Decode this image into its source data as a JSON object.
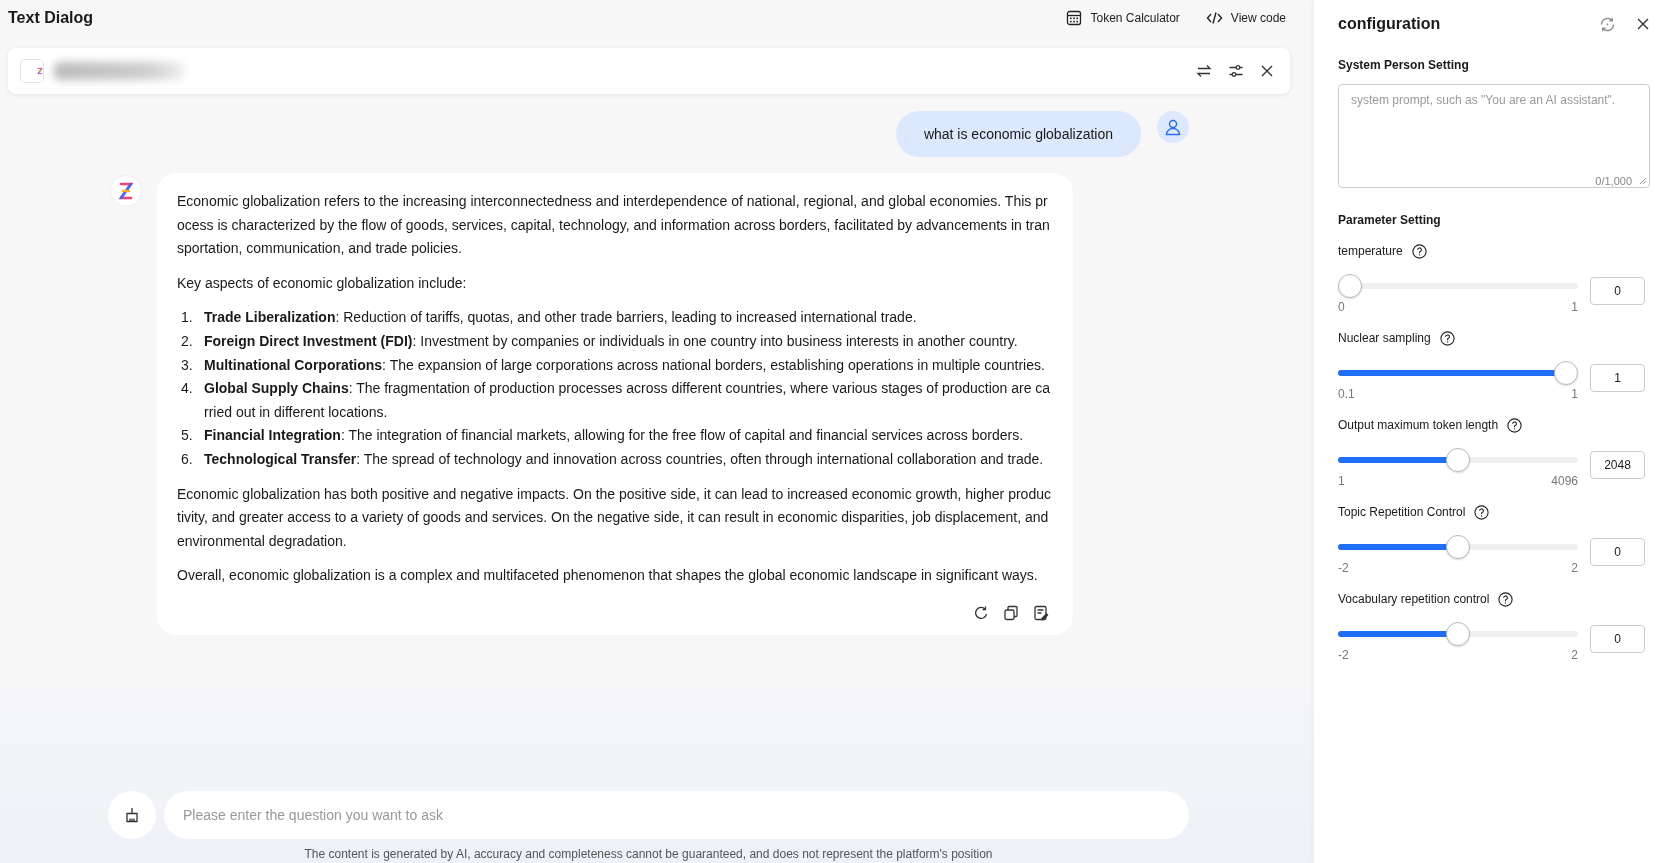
{
  "header": {
    "title": "Text Dialog",
    "actions": [
      {
        "kind": "calculator",
        "label": "Token Calculator"
      },
      {
        "kind": "code",
        "label": "View code"
      }
    ]
  },
  "chat": {
    "user_message": "what is economic globalization",
    "assistant_message": [
      {
        "kind": "paragraph",
        "text": "Economic globalization refers to the increasing interconnectedness and interdependence of national, regional, and global economies. This process is characterized by the flow of goods, services, capital, technology, and information across borders, facilitated by advancements in transportation, communication, and trade policies."
      },
      {
        "kind": "paragraph",
        "text": "Key aspects of economic globalization include:"
      },
      {
        "kind": "list",
        "items": [
          {
            "number": "1.",
            "text": "**Trade Liberalization**: Reduction of tariffs, quotas, and other trade barriers, leading to increased international trade."
          },
          {
            "number": "2.",
            "text": "**Foreign Direct Investment (FDI)**: Investment by companies or individuals in one country into business interests in another country."
          },
          {
            "number": "3.",
            "text": "**Multinational Corporations**: The expansion of large corporations across national borders, establishing operations in multiple countries."
          },
          {
            "number": "4.",
            "text": "**Global Supply Chains**: The fragmentation of production processes across different countries, where various stages of production are carried out in different locations."
          },
          {
            "number": "5.",
            "text": "**Financial Integration**: The integration of financial markets, allowing for the free flow of capital and financial services across borders."
          },
          {
            "number": "6.",
            "text": "**Technological Transfer**: The spread of technology and innovation across countries, often through international collaboration and trade."
          }
        ]
      },
      {
        "kind": "paragraph",
        "text": "Economic globalization has both positive and negative impacts. On the positive side, it can lead to increased economic growth, higher productivity, and greater access to a variety of goods and services. On the negative side, it can result in economic disparities, job displacement, and environmental degradation."
      },
      {
        "kind": "paragraph",
        "text": "Overall, economic globalization is a complex and multifaceted phenomenon that shapes the global economic landscape in significant ways."
      }
    ]
  },
  "input": {
    "placeholder": "Please enter the question you want to ask"
  },
  "disclaimer": "The content is generated by AI, accuracy and completeness cannot be guaranteed, and does not represent the platform's position",
  "configuration": {
    "title": "configuration",
    "system_person_setting": {
      "heading": "System Person Setting",
      "placeholder": "system prompt, such as \"You are an AI assistant\".",
      "counter": "0/1,000"
    },
    "parameter_setting": {
      "heading": "Parameter Setting",
      "parameters": [
        {
          "label": "temperature",
          "min": "0",
          "max": "1",
          "value": "0",
          "level": 0
        },
        {
          "label": "Nuclear sampling",
          "min": "0.1",
          "max": "1",
          "value": "1",
          "level": 1
        },
        {
          "label": "Output maximum token length",
          "min": "1",
          "max": "4096",
          "value": "2048",
          "level": 0.5
        },
        {
          "label": "Topic Repetition Control",
          "min": "-2",
          "max": "2",
          "value": "0",
          "level": 0.5
        },
        {
          "label": "Vocabulary repetition control",
          "min": "-2",
          "max": "2",
          "value": "0",
          "level": 0.5
        }
      ]
    }
  }
}
